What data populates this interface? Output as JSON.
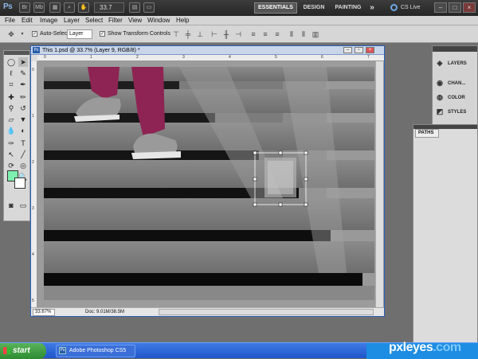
{
  "app": {
    "logo": "Ps"
  },
  "topbar": {
    "zoom": "33.7",
    "workspaces": [
      "ESSENTIALS",
      "DESIGN",
      "PAINTING"
    ],
    "more": "»",
    "cs_live": "CS Live"
  },
  "menu": [
    "File",
    "Edit",
    "Image",
    "Layer",
    "Select",
    "Filter",
    "View",
    "Window",
    "Help"
  ],
  "options": {
    "auto_select_label": "Auto-Select:",
    "auto_select_value": "Layer",
    "transform_label": "Show Transform Controls"
  },
  "panels": [
    "LAYERS",
    "CHAN...",
    "COLOR",
    "STYLES"
  ],
  "paths_tab": "PATHS",
  "document": {
    "title": "This 1.psd @ 33.7% (Layer 9, RGB/8) *",
    "zoom": "33.67%",
    "doc_size": "Doc: 9.01M/38.5M",
    "ruler_top": [
      "0",
      "1",
      "2",
      "3",
      "4",
      "5",
      "6",
      "7"
    ],
    "ruler_left": [
      "0",
      "1",
      "2",
      "3",
      "4",
      "5"
    ]
  },
  "colors": {
    "foreground": "#7ef0b0",
    "background": "#ffffff",
    "accent": "#2b5fb8",
    "jeans": "#8e2453"
  },
  "taskbar": {
    "start": "start",
    "app": "Adobe Photoshop CS5"
  },
  "watermark": {
    "brand": "pxleyes",
    "tld": ".com"
  }
}
